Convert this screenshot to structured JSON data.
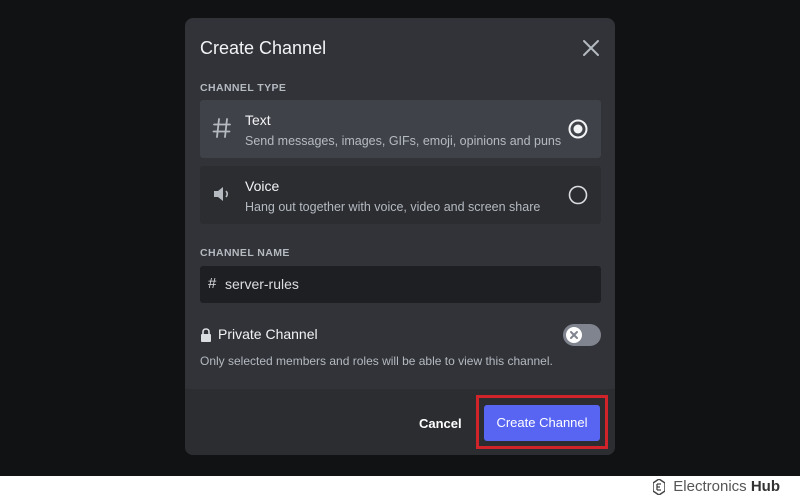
{
  "modal": {
    "title": "Create Channel",
    "channel_type_label": "CHANNEL TYPE",
    "options": [
      {
        "icon": "hash-icon",
        "title": "Text",
        "description": "Send messages, images, GIFs, emoji, opinions and puns",
        "selected": true
      },
      {
        "icon": "speaker-icon",
        "title": "Voice",
        "description": "Hang out together with voice, video and screen share",
        "selected": false
      }
    ],
    "channel_name_label": "CHANNEL NAME",
    "channel_name_prefix": "#",
    "channel_name_value": "server-rules",
    "private": {
      "label": "Private Channel",
      "description": "Only selected members and roles will be able to view this channel.",
      "enabled": false
    },
    "footer": {
      "cancel_label": "Cancel",
      "create_label": "Create Channel"
    }
  },
  "colors": {
    "accent": "#5865f2",
    "highlight": "#d0242a",
    "modal_bg": "#313338",
    "backdrop": "#111214"
  },
  "watermark": {
    "brand_prefix": "Electronics",
    "brand_suffix": "Hub"
  }
}
